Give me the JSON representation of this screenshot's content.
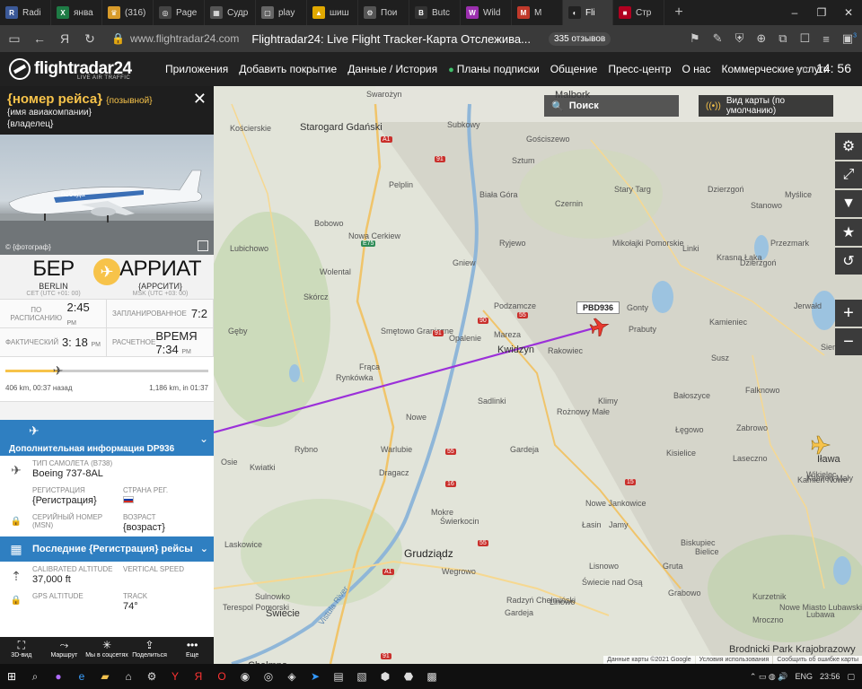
{
  "browser": {
    "tabs": [
      {
        "label": "Radi",
        "color": "#3b5998",
        "glyph": "R"
      },
      {
        "label": "янва",
        "color": "#1e7b45",
        "glyph": "X"
      },
      {
        "label": "(316)",
        "color": "#d89b2a",
        "glyph": "♛"
      },
      {
        "label": "Page",
        "color": "#444444",
        "glyph": "◎"
      },
      {
        "label": "Судр",
        "color": "#555555",
        "glyph": "▦"
      },
      {
        "label": "play",
        "color": "#666666",
        "glyph": "▢"
      },
      {
        "label": "шиш",
        "color": "#e0a800",
        "glyph": "▲"
      },
      {
        "label": "Пои",
        "color": "#555555",
        "glyph": "⚙"
      },
      {
        "label": "Butc",
        "color": "#333333",
        "glyph": "B"
      },
      {
        "label": "Wild",
        "color": "#9b2fae",
        "glyph": "W"
      },
      {
        "label": "М",
        "color": "#c0392b",
        "glyph": "М"
      },
      {
        "label": "Fli",
        "color": "#222222",
        "glyph": "◐"
      },
      {
        "label": "Стр",
        "color": "#b00020",
        "glyph": "■"
      }
    ],
    "active_tab_index": 11,
    "url_host": "www.flightradar24.com",
    "page_title": "Flightradar24: Live Flight Tracker-Карта Отслежива...",
    "reviews": "335 отзывов",
    "ext_badge": "3"
  },
  "header": {
    "logo_name": "flightradar24",
    "logo_sub": "LIVE AIR TRAFFIC",
    "menu": [
      "Приложения",
      "Добавить покрытие",
      "Данные / История",
      "Планы подписки",
      "Общение",
      "Пресс-центр",
      "О нас",
      "Коммерческие услуги"
    ],
    "clock_tz": "UTC",
    "clock_time": "14: 56"
  },
  "panel": {
    "flight": "{номер рейса}",
    "callsign": "{позывной}",
    "airline": "{имя авиакомпании}",
    "owner": "{владелец}",
    "photo_credit": "© {фотограф}",
    "origin": {
      "code": "БЕР",
      "city": "BERLIN",
      "tz": "CET (UTC +01: 00)"
    },
    "destination": {
      "code": "АРРИАТ",
      "city": "{АРРСИТИ}",
      "tz": "MSK (UTC +03: 00)"
    },
    "times": [
      {
        "label": "ПО РАСПИСАНИЮ",
        "value": "2:45",
        "ampm": "PM"
      },
      {
        "label": "ЗАПЛАНИРОВАННОЕ",
        "value": "7:2",
        "ampm": ""
      },
      {
        "label": "ФАКТИЧЕСКИЙ",
        "value": "3: 18",
        "ampm": "PM"
      },
      {
        "label": "РАСЧЕТНОЕ",
        "value": "ВРЕМЯ 7:34",
        "ampm": "PM"
      }
    ],
    "progress_fraction": 0.26,
    "progress_left": "406 km, 00:37 назад",
    "progress_right": "1,186 km, in 01:37",
    "more_info": "Дополнительная информация DP936",
    "aircraft_type_label": "ТИП САМОЛЕТА",
    "aircraft_type_code": "(B738)",
    "aircraft_type": "Boeing 737-8AL",
    "registration_label": "РЕГИСТРАЦИЯ",
    "registration": "{Регистрация}",
    "country_label": "СТРАНА РЕГ.",
    "msn_label": "СЕРИЙНЫЙ НОМЕР (MSN)",
    "age_label": "ВОЗРАСТ",
    "age": "{возраст}",
    "last_flights": "Последние {Регистрация} рейсы",
    "cal_alt_label": "CALIBRATED ALTITUDE",
    "cal_alt": "37,000 ft",
    "vspeed_label": "VERTICAL SPEED",
    "gps_alt_label": "GPS ALTITUDE",
    "track_label": "TRACK",
    "track": "74°",
    "tools": [
      {
        "label": "3D-вид",
        "icon": "⛶"
      },
      {
        "label": "Маршрут",
        "icon": "⤳"
      },
      {
        "label": "Мы в соцсетях",
        "icon": "✳"
      },
      {
        "label": "Поделиться",
        "icon": "⇪"
      },
      {
        "label": "Еще",
        "icon": "•••"
      }
    ]
  },
  "map": {
    "search": "Поиск",
    "map_view": "Вид карты (по умолчанию)",
    "callsign_label": "PBD936",
    "attributions": [
      "Данные карты ©2021 Google",
      "Условия использования",
      "Сообщить об ошибке карты"
    ],
    "labels": [
      {
        "t": "Malbork",
        "cls": "city"
      },
      {
        "t": "Starogard Gdański",
        "cls": "city"
      },
      {
        "t": "Kościerskie",
        "cls": ""
      },
      {
        "t": "Swarożyn",
        "cls": ""
      },
      {
        "t": "Subkowy",
        "cls": ""
      },
      {
        "t": "Pelplin",
        "cls": ""
      },
      {
        "t": "Gościszewo",
        "cls": ""
      },
      {
        "t": "Sztum",
        "cls": ""
      },
      {
        "t": "Stary Targ",
        "cls": ""
      },
      {
        "t": "Dzierzgoń",
        "cls": ""
      },
      {
        "t": "Czernin",
        "cls": ""
      },
      {
        "t": "Biała Góra",
        "cls": ""
      },
      {
        "t": "Bobowo",
        "cls": ""
      },
      {
        "t": "Nowa Cerkiew",
        "cls": ""
      },
      {
        "t": "Ryjewo",
        "cls": ""
      },
      {
        "t": "Mikołajki Pomorskie",
        "cls": ""
      },
      {
        "t": "Linki",
        "cls": ""
      },
      {
        "t": "Stanowo",
        "cls": ""
      },
      {
        "t": "Myślice",
        "cls": ""
      },
      {
        "t": "Przezmark",
        "cls": ""
      },
      {
        "t": "Lubichowo",
        "cls": ""
      },
      {
        "t": "Gniew",
        "cls": ""
      },
      {
        "t": "Krasna Łąka",
        "cls": ""
      },
      {
        "t": "Dzierzgoń",
        "cls": ""
      },
      {
        "t": "Wolental",
        "cls": ""
      },
      {
        "t": "Skórcz",
        "cls": ""
      },
      {
        "t": "Podzamcze",
        "cls": ""
      },
      {
        "t": "Jerwałd",
        "cls": ""
      },
      {
        "t": "Gonty",
        "cls": ""
      },
      {
        "t": "Kamieniec",
        "cls": ""
      },
      {
        "t": "Prabuty",
        "cls": ""
      },
      {
        "t": "Gęby",
        "cls": ""
      },
      {
        "t": "Smętowo Graniczne",
        "cls": ""
      },
      {
        "t": "Opalenie",
        "cls": ""
      },
      {
        "t": "Mareza",
        "cls": ""
      },
      {
        "t": "Kwidzyn",
        "cls": "city"
      },
      {
        "t": "Rakowiec",
        "cls": ""
      },
      {
        "t": "Susz",
        "cls": ""
      },
      {
        "t": "Siemiany",
        "cls": ""
      },
      {
        "t": "Frąca",
        "cls": ""
      },
      {
        "t": "Rynkówka",
        "cls": ""
      },
      {
        "t": "Sadlinki",
        "cls": ""
      },
      {
        "t": "Klimy",
        "cls": ""
      },
      {
        "t": "Bałoszyce",
        "cls": ""
      },
      {
        "t": "Falknowo",
        "cls": ""
      },
      {
        "t": "Nowe",
        "cls": ""
      },
      {
        "t": "Rożnowy Małe",
        "cls": ""
      },
      {
        "t": "Łęgowo",
        "cls": ""
      },
      {
        "t": "Zabrowo",
        "cls": ""
      },
      {
        "t": "Rybno",
        "cls": ""
      },
      {
        "t": "Warlubie",
        "cls": ""
      },
      {
        "t": "Gardeja",
        "cls": ""
      },
      {
        "t": "Kisielice",
        "cls": ""
      },
      {
        "t": "Laseczno",
        "cls": ""
      },
      {
        "t": "Iława",
        "cls": "city"
      },
      {
        "t": "Osie",
        "cls": ""
      },
      {
        "t": "Kwiatki",
        "cls": ""
      },
      {
        "t": "Dragacz",
        "cls": ""
      },
      {
        "t": "Nowe Jankowice",
        "cls": ""
      },
      {
        "t": "Kamień Mały",
        "cls": ""
      },
      {
        "t": "Wikielec",
        "cls": ""
      },
      {
        "t": "Mokre",
        "cls": ""
      },
      {
        "t": "Świerkocin",
        "cls": ""
      },
      {
        "t": "Łasin",
        "cls": ""
      },
      {
        "t": "Kamień Nowe",
        "cls": ""
      },
      {
        "t": "Jamy",
        "cls": ""
      },
      {
        "t": "Laskowice",
        "cls": ""
      },
      {
        "t": "Grudziądz",
        "cls": "bigcity"
      },
      {
        "t": "Biskupiec",
        "cls": ""
      },
      {
        "t": "Bielice",
        "cls": ""
      },
      {
        "t": "Wegrowo",
        "cls": ""
      },
      {
        "t": "Lisnowo",
        "cls": ""
      },
      {
        "t": "Gruta",
        "cls": ""
      },
      {
        "t": "Świecie nad Osą",
        "cls": ""
      },
      {
        "t": "Kurzetnik",
        "cls": ""
      },
      {
        "t": "Grabowo",
        "cls": ""
      },
      {
        "t": "Sulnowko",
        "cls": ""
      },
      {
        "t": "Świecie",
        "cls": "city"
      },
      {
        "t": "Radzyń Chełmiński",
        "cls": ""
      },
      {
        "t": "Linowo",
        "cls": ""
      },
      {
        "t": "Nowe Miasto Lubawskie",
        "cls": ""
      },
      {
        "t": "Lubawa",
        "cls": ""
      },
      {
        "t": "Mroczno",
        "cls": ""
      },
      {
        "t": "Terespol Pomorski",
        "cls": ""
      },
      {
        "t": "Chełmno",
        "cls": "city"
      },
      {
        "t": "Brodnicki Park Krajobrazowy",
        "cls": "city"
      },
      {
        "t": "Gardeja",
        "cls": ""
      },
      {
        "t": "Vistula River",
        "cls": ""
      }
    ],
    "shields": [
      {
        "t": "A1",
        "cls": ""
      },
      {
        "t": "91",
        "cls": ""
      },
      {
        "t": "E75",
        "cls": "e"
      },
      {
        "t": "90",
        "cls": ""
      },
      {
        "t": "55",
        "cls": ""
      },
      {
        "t": "91",
        "cls": ""
      },
      {
        "t": "55",
        "cls": ""
      },
      {
        "t": "16",
        "cls": ""
      },
      {
        "t": "A1",
        "cls": ""
      },
      {
        "t": "91",
        "cls": ""
      },
      {
        "t": "55",
        "cls": ""
      },
      {
        "t": "15",
        "cls": ""
      }
    ]
  },
  "taskbar": {
    "lang": "ENG",
    "time": "23:56"
  }
}
